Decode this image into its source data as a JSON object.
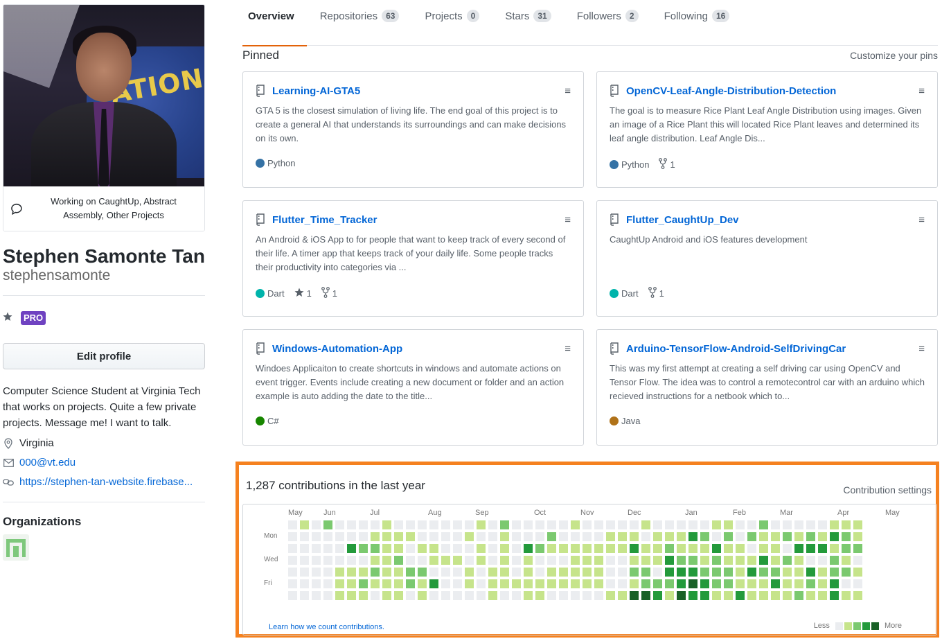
{
  "profile": {
    "status": "Working on CaughtUp, Abstract Assembly, Other Projects",
    "fullname": "Stephen Samonte Tan",
    "username": "stephensamonte",
    "pro": "PRO",
    "edit_profile": "Edit profile",
    "bio": "Computer Science Student at Virginia Tech that works on projects. Quite a few private projects. Message me! I want to talk.",
    "location": "Virginia",
    "email": "000@vt.edu",
    "website": "https://stephen-tan-website.firebase...",
    "orgs_title": "Organizations"
  },
  "nav": {
    "tabs": [
      {
        "label": "Overview",
        "count": ""
      },
      {
        "label": "Repositories",
        "count": "63"
      },
      {
        "label": "Projects",
        "count": "0"
      },
      {
        "label": "Stars",
        "count": "31"
      },
      {
        "label": "Followers",
        "count": "2"
      },
      {
        "label": "Following",
        "count": "16"
      }
    ]
  },
  "pinned": {
    "title": "Pinned",
    "customize": "Customize your pins",
    "repos": [
      {
        "name": "Learning-AI-GTA5",
        "desc": "GTA 5 is the closest simulation of living life. The end goal of this project is to create a general AI that understands its surroundings and can make decisions on its own.",
        "lang": "Python",
        "lang_color": "#3572A5",
        "stars": "",
        "forks": ""
      },
      {
        "name": "OpenCV-Leaf-Angle-Distribution-Detection",
        "desc": "The goal is to measure Rice Plant Leaf Angle Distribution using images. Given an image of a Rice Plant this will located Rice Plant leaves and determined its leaf angle distribution. Leaf Angle Dis...",
        "lang": "Python",
        "lang_color": "#3572A5",
        "stars": "",
        "forks": "1"
      },
      {
        "name": "Flutter_Time_Tracker",
        "desc": "An Android & iOS App to for people that want to keep track of every second of their life. A timer app that keeps track of your daily life. Some people tracks their productivity into categories via ...",
        "lang": "Dart",
        "lang_color": "#00B4AB",
        "stars": "1",
        "forks": "1"
      },
      {
        "name": "Flutter_CaughtUp_Dev",
        "desc": "CaughtUp Android and iOS features development",
        "lang": "Dart",
        "lang_color": "#00B4AB",
        "stars": "",
        "forks": "1"
      },
      {
        "name": "Windows-Automation-App",
        "desc": "Windoes Applicaiton to create shortcuts in windows and automate actions on event trigger. Events include creating a new document or folder and an action example is auto adding the date to the title...",
        "lang": "C#",
        "lang_color": "#178600",
        "stars": "",
        "forks": ""
      },
      {
        "name": "Arduino-TensorFlow-Android-SelfDrivingCar",
        "desc": "This was my first attempt at creating a self driving car using OpenCV and Tensor Flow. The idea was to control a remotecontrol car with an arduino which recieved instructions for a netbook which to...",
        "lang": "Java",
        "lang_color": "#B07219",
        "stars": "",
        "forks": ""
      }
    ]
  },
  "contributions": {
    "title": "1,287 contributions in the last year",
    "settings": "Contribution settings",
    "months": [
      "May",
      "Jun",
      "Jul",
      "Aug",
      "Sep",
      "Oct",
      "Nov",
      "Dec",
      "Jan",
      "Feb",
      "Mar",
      "Apr",
      "May"
    ],
    "day_labels": [
      "Mon",
      "Wed",
      "Fri"
    ],
    "learn": "Learn how we count contributions.",
    "less": "Less",
    "more": "More",
    "colors": [
      "#ebedf0",
      "#c6e48b",
      "#7bc96f",
      "#239a3b",
      "#196127"
    ],
    "levels": [
      "0102000010000000102000001000001000001100200000111",
      "0000000111100001001000200001110111320202112121321",
      "0000032211011000101032111111131121113110110333122",
      "0000000112001110101010001110011132212111312100210",
      "0000111211220001011010111110022033322213221131221",
      "0000112111213001011111111110012223432211131121300",
      "0000111011010000010011000001144314331131111211311"
    ]
  }
}
